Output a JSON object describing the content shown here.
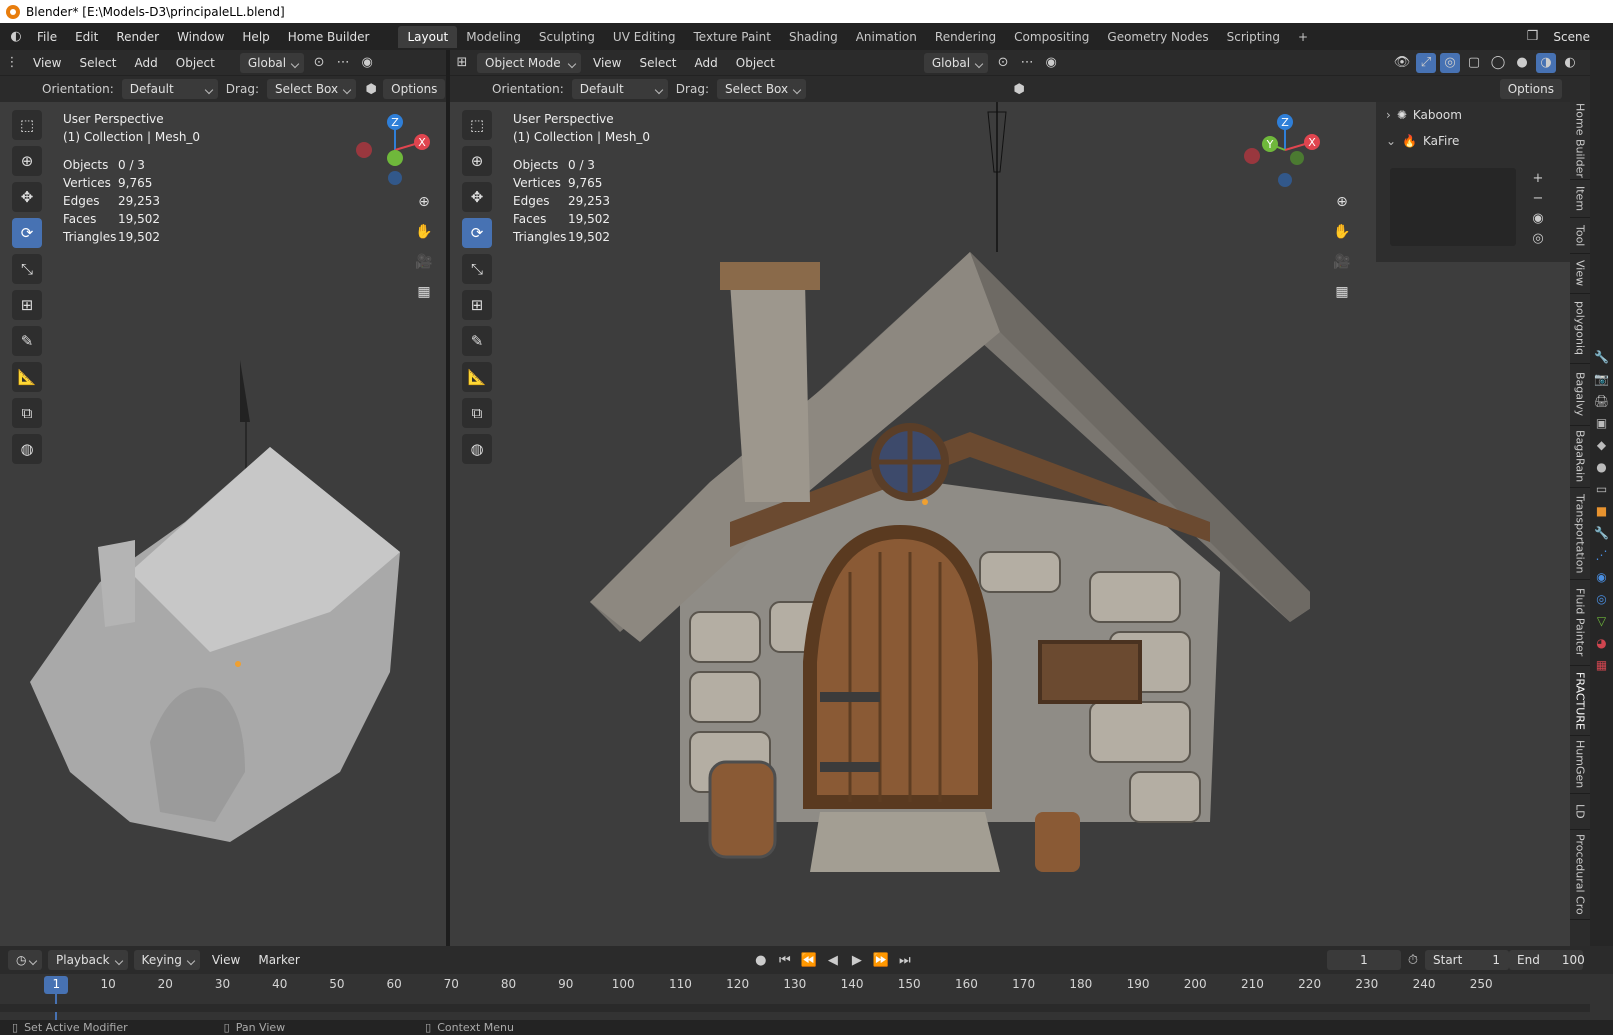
{
  "window": {
    "title": "Blender* [E:\\Models-D3\\principaleLL.blend]"
  },
  "menu": [
    "File",
    "Edit",
    "Render",
    "Window",
    "Help",
    "Home Builder"
  ],
  "workspaces": [
    "Layout",
    "Modeling",
    "Sculpting",
    "UV Editing",
    "Texture Paint",
    "Shading",
    "Animation",
    "Rendering",
    "Compositing",
    "Geometry Nodes",
    "Scripting"
  ],
  "active_workspace": "Layout",
  "scene": "Scene",
  "left_view": {
    "menus": [
      "View",
      "Select",
      "Add",
      "Object"
    ],
    "transform": "Global",
    "orientation_label": "Orientation:",
    "orientation": "Default",
    "drag_label": "Drag:",
    "drag": "Select Box",
    "options": "Options",
    "perspective": "User Perspective",
    "collection": "(1) Collection | Mesh_0"
  },
  "right_view": {
    "mode": "Object Mode",
    "menus": [
      "View",
      "Select",
      "Add",
      "Object"
    ],
    "transform": "Global",
    "orientation_label": "Orientation:",
    "orientation": "Default",
    "drag_label": "Drag:",
    "drag": "Select Box",
    "options": "Options",
    "perspective": "User Perspective",
    "collection": "(1) Collection | Mesh_0"
  },
  "stats": {
    "objects_label": "Objects",
    "objects": "0 / 3",
    "vertices_label": "Vertices",
    "vertices": "9,765",
    "edges_label": "Edges",
    "edges": "29,253",
    "faces_label": "Faces",
    "faces": "19,502",
    "triangles_label": "Triangles",
    "triangles": "19,502"
  },
  "gizmo": {
    "z": "Z",
    "y": "Y",
    "x": "X"
  },
  "npanel": {
    "items": [
      "Kaboom",
      "KaFire"
    ],
    "tabs": [
      "Home Builder",
      "Item",
      "Tool",
      "View",
      "polygoniq",
      "Bagalvy",
      "BagaRain",
      "Transportation",
      "Fluid Painter",
      "FRACTURE",
      "HumGen",
      "LD",
      "Procedural Cro"
    ]
  },
  "timeline": {
    "menus": [
      "Playback",
      "Keying",
      "View",
      "Marker"
    ],
    "current_frame": "1",
    "start_label": "Start",
    "start": "1",
    "end_label": "End",
    "end": "100",
    "ticks": [
      "1",
      "10",
      "20",
      "30",
      "40",
      "50",
      "60",
      "70",
      "80",
      "90",
      "100",
      "110",
      "120",
      "130",
      "140",
      "150",
      "160",
      "170",
      "180",
      "190",
      "200",
      "210",
      "220",
      "230",
      "240",
      "250"
    ]
  },
  "status": {
    "left": "Set Active Modifier",
    "middle": "Pan View",
    "right": "Context Menu"
  },
  "colors": {
    "accent": "#4772b3",
    "axis_x": "#e0454f",
    "axis_y": "#6fb83b",
    "axis_z": "#2f7fd8"
  }
}
